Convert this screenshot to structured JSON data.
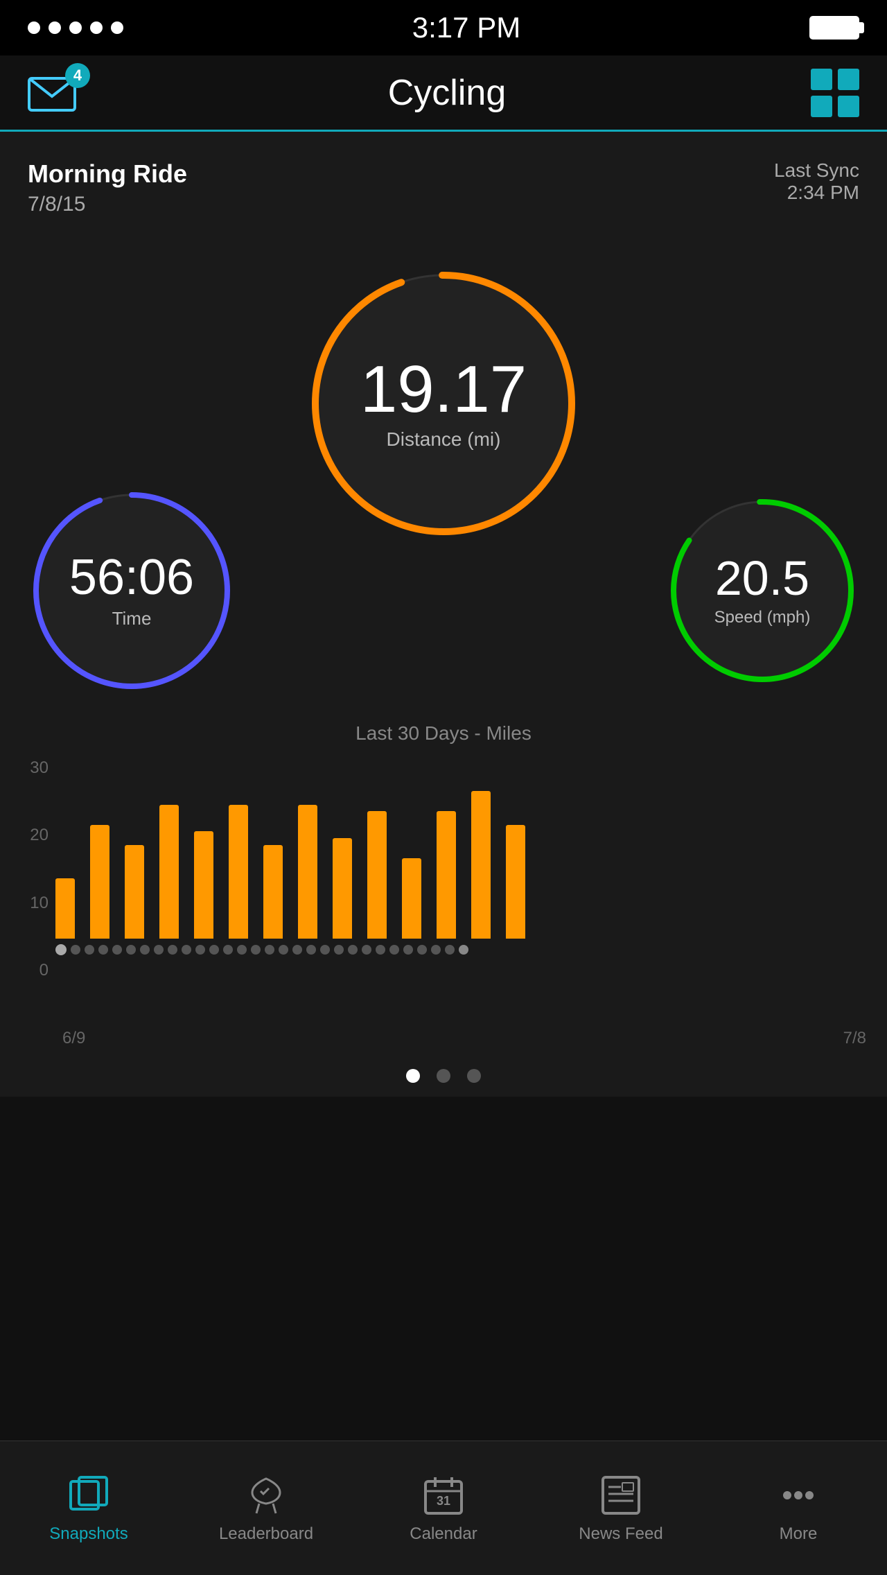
{
  "statusBar": {
    "time": "3:17 PM",
    "dots": 5
  },
  "header": {
    "title": "Cycling",
    "badgeCount": "4",
    "gridIconLabel": "grid-icon"
  },
  "rideInfo": {
    "name": "Morning Ride",
    "date": "7/8/15",
    "syncLabel": "Last Sync",
    "syncTime": "2:34 PM"
  },
  "gauges": {
    "center": {
      "value": "19.17",
      "label": "Distance (mi)",
      "color": "#f80"
    },
    "left": {
      "value": "56:06",
      "label": "Time",
      "color": "#66f"
    },
    "right": {
      "value": "20.5",
      "label": "Speed (mph)",
      "color": "#0d0"
    }
  },
  "chart": {
    "title": "Last 30 Days - Miles",
    "yLabels": [
      "30",
      "20",
      "10",
      "0"
    ],
    "xLabelStart": "6/9",
    "xLabelEnd": "7/8",
    "bars": [
      9,
      17,
      14,
      20,
      16,
      20,
      14,
      20,
      15,
      19,
      12,
      19,
      22,
      17
    ],
    "maxValue": 30
  },
  "pageIndicators": [
    {
      "active": true
    },
    {
      "active": false
    },
    {
      "active": false
    }
  ],
  "bottomNav": [
    {
      "label": "Snapshots",
      "active": true,
      "icon": "snapshots-icon"
    },
    {
      "label": "Leaderboard",
      "active": false,
      "icon": "leaderboard-icon"
    },
    {
      "label": "Calendar",
      "active": false,
      "icon": "calendar-icon"
    },
    {
      "label": "News Feed",
      "active": false,
      "icon": "newsfeed-icon"
    },
    {
      "label": "More",
      "active": false,
      "icon": "more-icon"
    }
  ]
}
